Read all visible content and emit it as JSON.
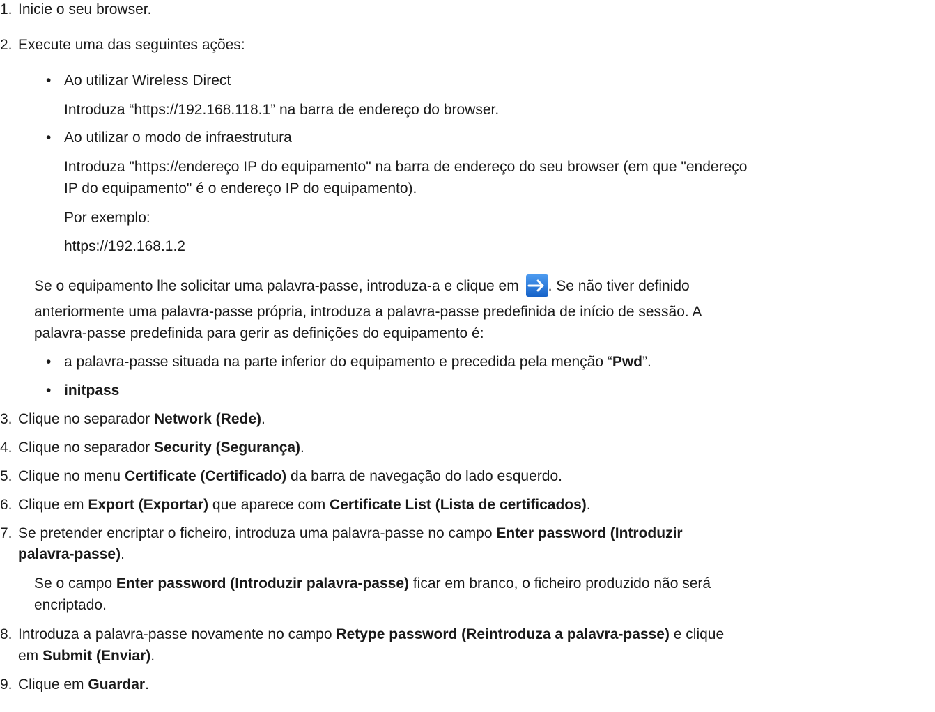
{
  "step1": {
    "num": "1.",
    "text": "Inicie o seu browser."
  },
  "step2": {
    "num": "2.",
    "text": "Execute uma das seguintes ações:",
    "bullet_a": {
      "mark": "•",
      "title": "Ao utilizar Wireless Direct",
      "desc": "Introduza “https://192.168.118.1” na barra de endereço do browser."
    },
    "bullet_b": {
      "mark": "•",
      "title": "Ao utilizar o modo de infraestrutura",
      "desc_line1": "Introduza \"https://endereço IP do equipamento\" na barra de endereço do seu browser (em que \"endereço",
      "desc_line2": "IP do equipamento\" é o endereço IP do equipamento).",
      "example_label": "Por exemplo:",
      "example_url": "https://192.168.1.2"
    },
    "password_note": {
      "line1_before": "Se o equipamento lhe solicitar uma palavra-passe, introduza-a e clique em",
      "line1_after": ". Se não tiver definido",
      "line2": "anteriormente uma palavra-passe própria, introduza a palavra-passe predefinida de início de sessão. A",
      "line3": "palavra-passe predefinida para gerir as definições do equipamento é:",
      "arrow_icon": "right-arrow-icon",
      "arrow_color": "#1e73d6"
    },
    "bullet_c": {
      "mark": "•",
      "before": "a palavra-passe situada na parte inferior do equipamento e precedida pela menção “",
      "bold": "Pwd",
      "after": "”."
    },
    "bullet_d": {
      "mark": "•",
      "bold": "initpass"
    }
  },
  "step3": {
    "num": "3.",
    "before": "Clique no separador ",
    "bold": "Network (Rede)",
    "after": "."
  },
  "step4": {
    "num": "4.",
    "before": "Clique no separador ",
    "bold": "Security (Segurança)",
    "after": "."
  },
  "step5": {
    "num": "5.",
    "before": "Clique no menu ",
    "bold": "Certificate (Certificado)",
    "after": " da barra de navegação do lado esquerdo."
  },
  "step6": {
    "num": "6.",
    "before": "Clique em ",
    "bold1": "Export (Exportar)",
    "middle": " que aparece com ",
    "bold2": "Certificate List (Lista de certificados)",
    "after": "."
  },
  "step7": {
    "num": "7.",
    "before": "Se pretender encriptar o ficheiro, introduza uma palavra-passe no campo ",
    "bold_line1": "Enter password (Introduzir",
    "bold_line2": "palavra-passe)",
    "after": ".",
    "note_before": "Se o campo ",
    "note_bold": "Enter password (Introduzir palavra-passe)",
    "note_after": " ficar em branco, o ficheiro produzido não será",
    "note_line2": "encriptado."
  },
  "step8": {
    "num": "8.",
    "before": "Introduza a palavra-passe novamente no campo ",
    "bold": "Retype password (Reintroduza a palavra-passe)",
    "after": " e clique",
    "line2_before": "em ",
    "line2_bold": "Submit (Enviar)",
    "line2_after": "."
  },
  "step9": {
    "num": "9.",
    "before": "Clique em ",
    "bold": "Guardar",
    "after": "."
  }
}
